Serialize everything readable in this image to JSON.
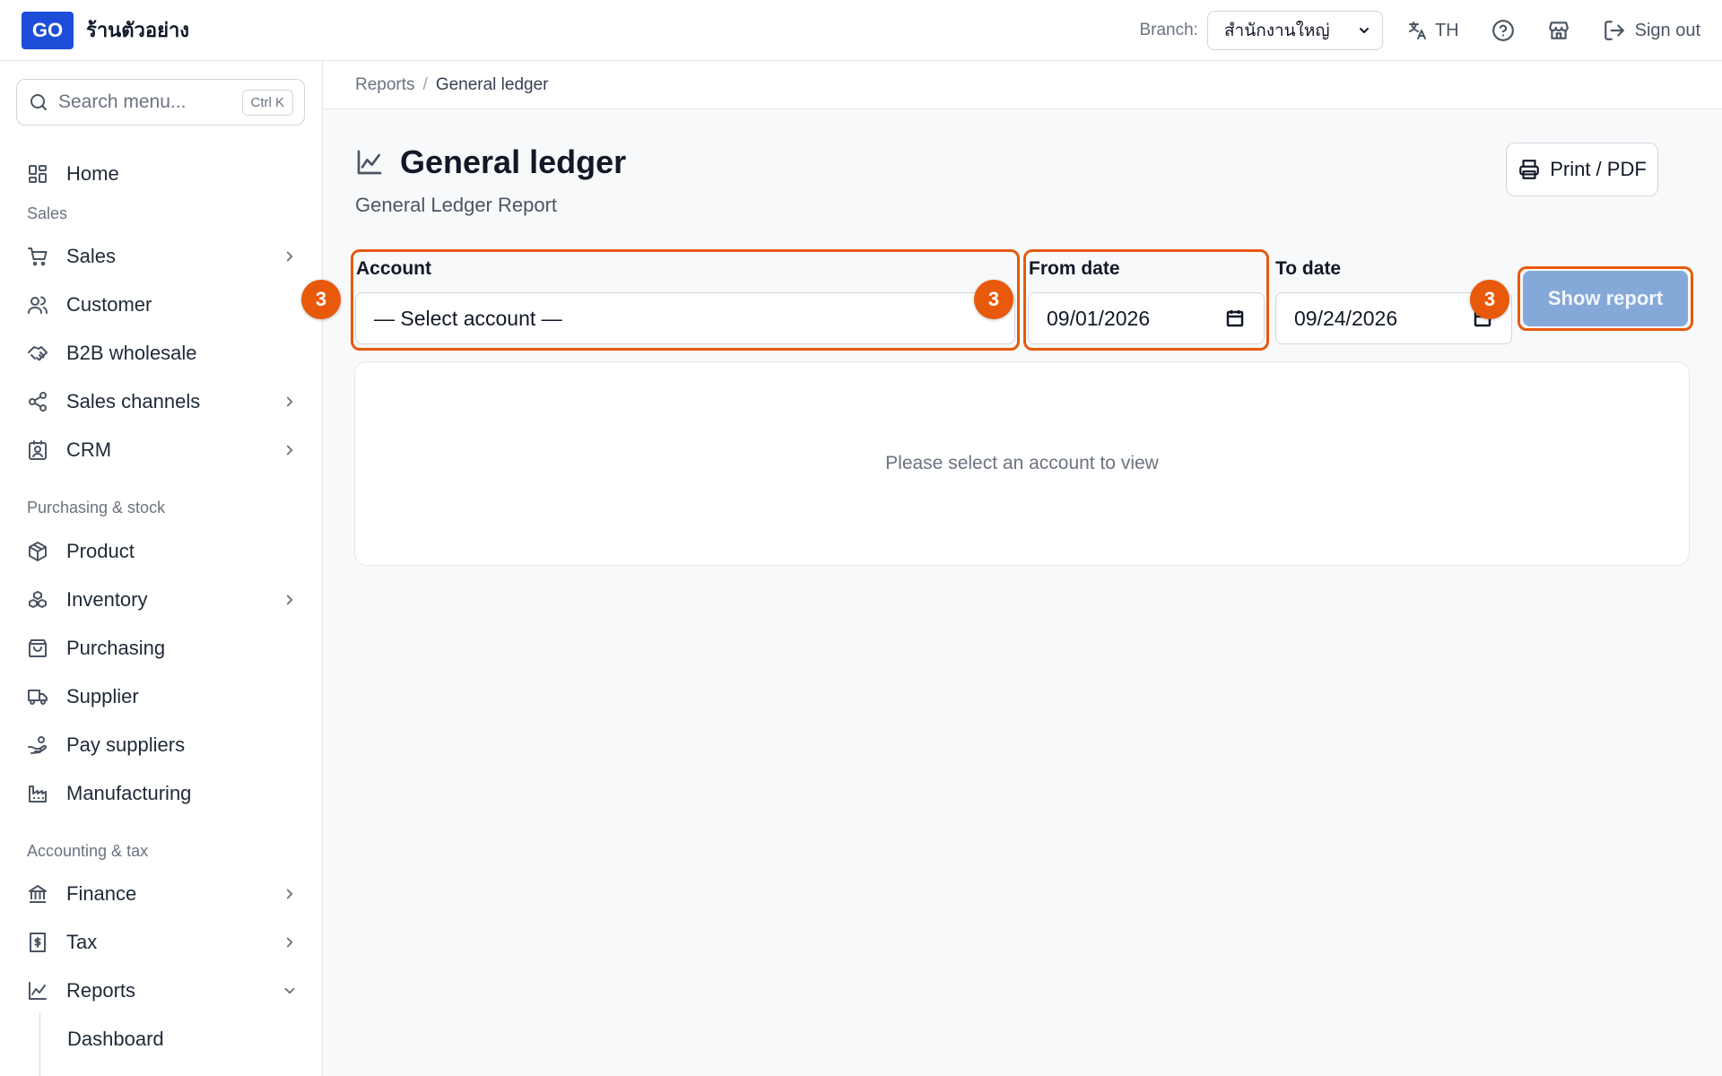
{
  "header": {
    "logo": "GO",
    "shop_name": "ร้านตัวอย่าง",
    "branch_label": "Branch:",
    "branch_value": "สำนักงานใหญ่",
    "lang": "TH",
    "sign_out": "Sign out"
  },
  "sidebar": {
    "search_placeholder": "Search menu...",
    "search_shortcut": "Ctrl K",
    "home": "Home",
    "sections": {
      "sales": "Sales",
      "purchasing": "Purchasing & stock",
      "accounting": "Accounting & tax"
    },
    "items": {
      "sales": "Sales",
      "customer": "Customer",
      "b2b": "B2B wholesale",
      "channels": "Sales channels",
      "crm": "CRM",
      "product": "Product",
      "inventory": "Inventory",
      "purchasing": "Purchasing",
      "supplier": "Supplier",
      "pay_suppliers": "Pay suppliers",
      "manufacturing": "Manufacturing",
      "finance": "Finance",
      "tax": "Tax",
      "reports": "Reports",
      "dashboard": "Dashboard"
    }
  },
  "breadcrumb": {
    "parent": "Reports",
    "separator": "/",
    "current": "General ledger"
  },
  "page": {
    "title": "General ledger",
    "subtitle": "General Ledger Report",
    "print_label": "Print / PDF"
  },
  "filters": {
    "account_label": "Account",
    "account_value": "— Select account —",
    "from_label": "From date",
    "from_value": "09/01/2026",
    "to_label": "To date",
    "to_value": "09/24/2026",
    "show_label": "Show report"
  },
  "annotations": {
    "badge": "3",
    "color": "#e8590c"
  },
  "empty_message": "Please select an account to view"
}
